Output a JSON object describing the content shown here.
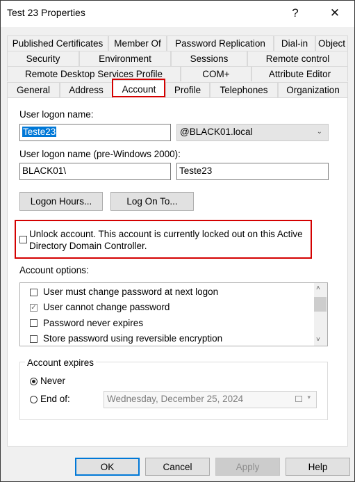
{
  "window": {
    "title": "Test 23 Properties",
    "help_glyph": "?",
    "close_glyph": "✕"
  },
  "tabs": {
    "row1": [
      "Published Certificates",
      "Member Of",
      "Password Replication",
      "Dial-in",
      "Object"
    ],
    "row2": [
      "Security",
      "Environment",
      "Sessions",
      "Remote control"
    ],
    "row3": [
      "Remote Desktop Services Profile",
      "COM+",
      "Attribute Editor"
    ],
    "row4": [
      "General",
      "Address",
      "Account",
      "Profile",
      "Telephones",
      "Organization"
    ],
    "active": "Account"
  },
  "account": {
    "logon_name_label": "User logon name:",
    "logon_name_value": "Teste23",
    "domain_value": "@BLACK01.local",
    "pre2000_label": "User logon name (pre-Windows 2000):",
    "pre2000_domain": "BLACK01\\",
    "pre2000_name": "Teste23",
    "logon_hours_label": "Logon Hours...",
    "log_on_to_label": "Log On To...",
    "unlock_line1": "Unlock account. This account is currently locked out on this Active",
    "unlock_line2": "Directory Domain Controller.",
    "options_label": "Account options:",
    "options": [
      {
        "label": "User must change password at next logon",
        "checked": false
      },
      {
        "label": "User cannot change password",
        "checked": true
      },
      {
        "label": "Password never expires",
        "checked": false
      },
      {
        "label": "Store password using reversible encryption",
        "checked": false
      }
    ],
    "expires_label": "Account expires",
    "never_label": "Never",
    "endof_label": "End of:",
    "endof_date": "Wednesday, December 25, 2024",
    "expires_selected": "Never"
  },
  "buttons": {
    "ok": "OK",
    "cancel": "Cancel",
    "apply": "Apply",
    "help": "Help"
  },
  "colors": {
    "highlight": "#d40000",
    "selection": "#0078d7"
  }
}
